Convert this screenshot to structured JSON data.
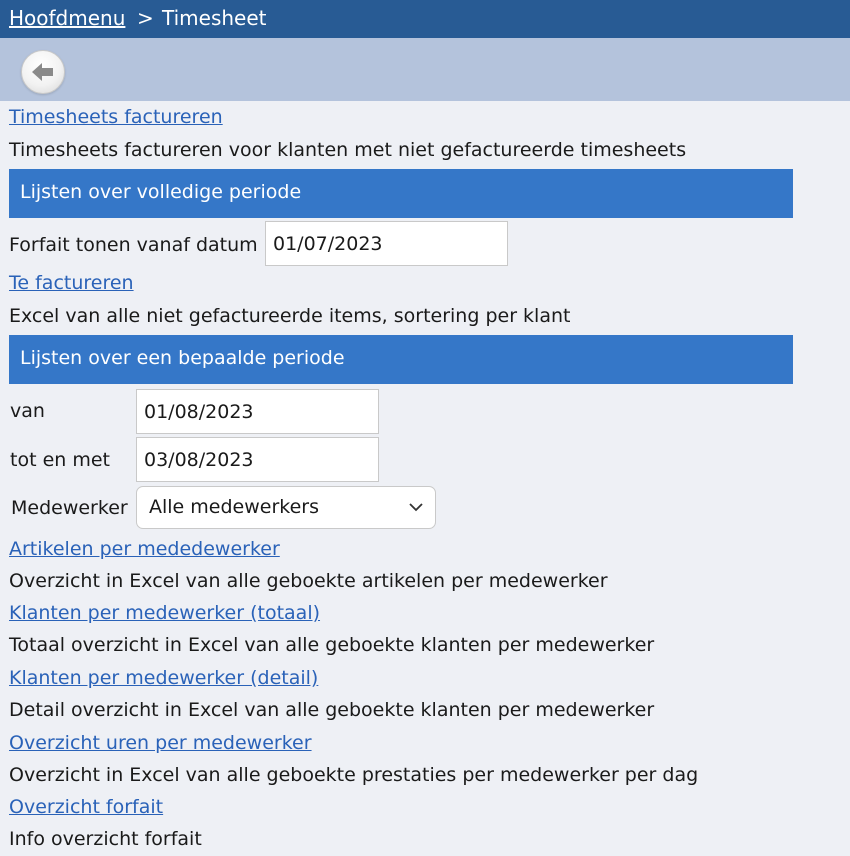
{
  "breadcrumb": {
    "home": "Hoofdmenu",
    "separator": ">",
    "current": "Timesheet"
  },
  "toolbar": {
    "back_icon": "arrow-left-icon"
  },
  "invoice": {
    "link": "Timesheets factureren",
    "description": "Timesheets factureren voor klanten met niet gefactureerde timesheets"
  },
  "full_period": {
    "header": "Lijsten over volledige periode",
    "forfait_label": "Forfait tonen vanaf datum",
    "forfait_date": "01/07/2023",
    "to_invoice_link": "Te factureren",
    "to_invoice_desc": "Excel van alle niet gefactureerde items, sortering per klant"
  },
  "period": {
    "header": "Lijsten over een bepaalde periode",
    "from_label": "van",
    "from_value": "01/08/2023",
    "to_label": "tot en met",
    "to_value": "03/08/2023",
    "employee_label": "Medewerker",
    "employee_selected": "Alle medewerkers"
  },
  "reports": [
    {
      "link": "Artikelen per mededewerker",
      "description": "Overzicht in Excel van alle geboekte artikelen per medewerker"
    },
    {
      "link": "Klanten per medewerker (totaal)",
      "description": "Totaal overzicht in Excel van alle geboekte klanten per medewerker"
    },
    {
      "link": "Klanten per medewerker (detail)",
      "description": "Detail overzicht in Excel van alle geboekte klanten per medewerker"
    },
    {
      "link": "Overzicht uren per medewerker",
      "description": "Overzicht in Excel van alle geboekte prestaties per medewerker per dag"
    },
    {
      "link": "Overzicht forfait",
      "description": "Info overzicht forfait"
    }
  ],
  "colors": {
    "topbar": "#285b94",
    "toolbar": "#b4c3dc",
    "section": "#3577c8",
    "link": "#2a62b8",
    "background": "#eef0f5"
  }
}
